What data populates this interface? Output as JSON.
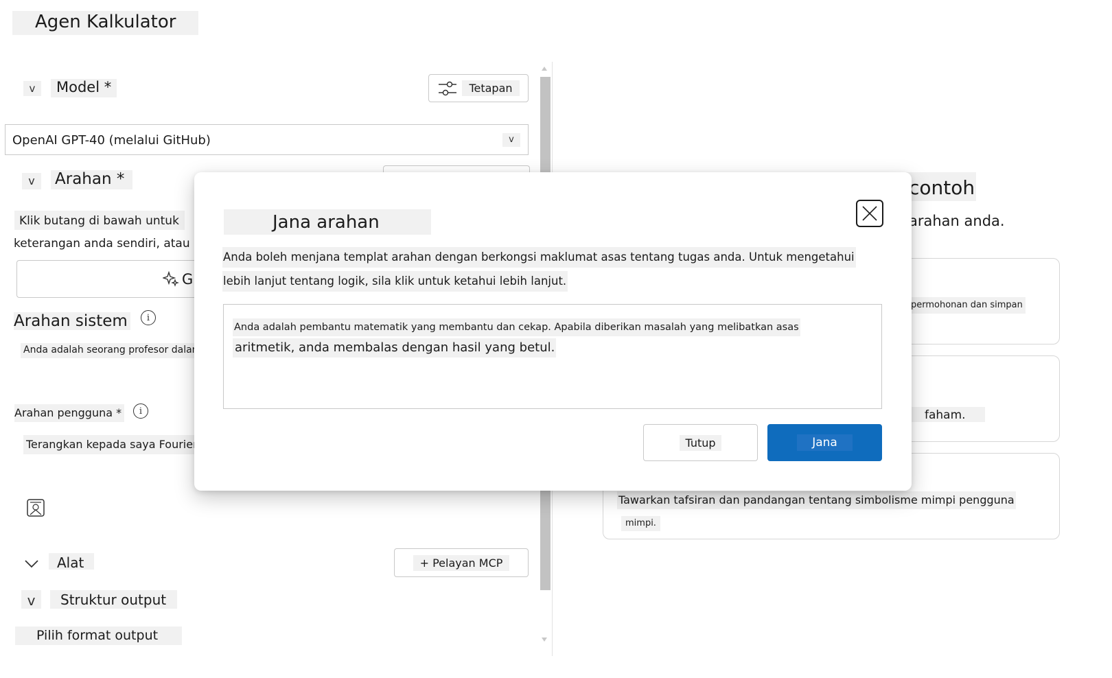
{
  "app": {
    "title": "Agen Kalkulator"
  },
  "left": {
    "model": {
      "label": "Model *",
      "settings_label": "Tetapan",
      "selected": "OpenAI GPT-40 (melalui GitHub)"
    },
    "prompt": {
      "label": "Arahan *",
      "help_line1": "Klik butang di bawah untuk",
      "help_line2": "keterangan anda sendiri, atau",
      "generate_fragment": "G"
    },
    "system": {
      "label": "Arahan sistem",
      "text": "Anda adalah seorang profesor dalam"
    },
    "user": {
      "label": "Arahan pengguna *",
      "text": "Terangkan kepada saya Fourier"
    },
    "tools": {
      "label": "Alat",
      "mcp_button": "+ Pelayan MCP"
    },
    "output": {
      "label": "Struktur output",
      "select_label": "Pilih format output"
    },
    "chevron": "v"
  },
  "right": {
    "heading_fragment": "contoh",
    "subtitle_fragment": "arahan anda.",
    "card1_text": "permohonan dan simpan",
    "card2_text": "faham.",
    "card3_line1": "Tawarkan tafsiran dan pandangan tentang simbolisme mimpi pengguna",
    "card3_line2": "mimpi."
  },
  "dialog": {
    "title": "Jana arahan",
    "description_line1": "Anda boleh menjana templat arahan dengan berkongsi maklumat asas tentang tugas anda. Untuk mengetahui",
    "description_line2": "lebih lanjut tentang logik, sila klik untuk ketahui lebih lanjut.",
    "input_line1": "Anda adalah pembantu matematik yang membantu dan cekap. Apabila diberikan masalah yang melibatkan asas",
    "input_line2": "aritmetik, anda membalas dengan hasil yang betul.",
    "close_button": "Tutup",
    "generate_button": "Jana"
  },
  "colors": {
    "primary": "#0f6cbd",
    "highlight": "#f1f1f1",
    "border": "#c8c8c8"
  },
  "icons": [
    "settings-sliders-icon",
    "chevron-down-icon",
    "sparkle-icon",
    "info-icon",
    "image-upload-icon",
    "close-icon"
  ]
}
